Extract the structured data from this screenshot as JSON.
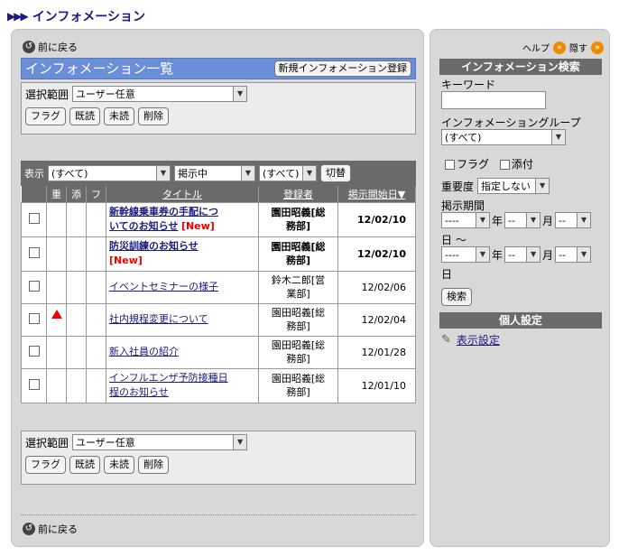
{
  "page": {
    "title": "インフォメーション"
  },
  "left": {
    "back_label": "前に戻る",
    "list_title": "インフォメーション一覧",
    "new_info_button": "新規インフォメーション登録",
    "scope_label": "選択範囲",
    "scope_value": "ユーザー任意",
    "actions": {
      "flag": "フラグ",
      "read": "既読",
      "unread": "未読",
      "delete": "削除"
    },
    "toolbar": {
      "display_label": "表示",
      "filter1": "(すべて)",
      "filter2": "掲示中",
      "filter3": "(すべて)",
      "switch_button": "切替"
    },
    "columns": {
      "importance": "重",
      "attachment": "添",
      "flag": "フ",
      "title": "タイトル",
      "registrant": "登録者",
      "start_date": "掲示開始日▼"
    },
    "rows": [
      {
        "title_line1": "新幹線乗車券の手配につ",
        "title_line2": "いてのお知らせ",
        "new": "[New]",
        "user_line1": "園田昭義[総",
        "user_line2": "務部]",
        "date": "12/02/10"
      },
      {
        "title_line1": "防災訓練のお知らせ",
        "title_line2": "",
        "new": "[New]",
        "user_line1": "園田昭義[総",
        "user_line2": "務部]",
        "date": "12/02/10"
      },
      {
        "title_line1": "イベントセミナーの様子",
        "title_line2": "",
        "new": "",
        "user_line1": "鈴木二郎[営",
        "user_line2": "業部]",
        "date": "12/02/06"
      },
      {
        "title_line1": "社内規程変更について",
        "title_line2": "",
        "new": "",
        "user_line1": "園田昭義[総",
        "user_line2": "務部]",
        "date": "12/02/04"
      },
      {
        "title_line1": "新入社員の紹介",
        "title_line2": "",
        "new": "",
        "user_line1": "園田昭義[総",
        "user_line2": "務部]",
        "date": "12/01/28"
      },
      {
        "title_line1": "インフルエンザ予防接種日",
        "title_line2": "程のお知らせ",
        "new": "",
        "user_line1": "園田昭義[総",
        "user_line2": "務部]",
        "date": "12/01/10"
      }
    ]
  },
  "right": {
    "help": "ヘルプ",
    "hide": "隠す",
    "search_title": "インフォメーション検索",
    "keyword_label": "キーワード",
    "group_label": "インフォメーショングループ",
    "group_value": "(すべて)",
    "flag_label": "フラグ",
    "attach_label": "添付",
    "importance_label": "重要度",
    "importance_value": "指定しない",
    "period_label": "掲示期間",
    "date_placeholder_year": "----",
    "date_placeholder": "--",
    "year_suffix": "年",
    "month_suffix": "月",
    "day_suffix": "日",
    "range_sep": "日 〜",
    "search_button": "検索",
    "personal_title": "個人設定",
    "display_settings": "表示設定"
  },
  "colors": {
    "header_blue": "#6a8fd8",
    "panel_gray": "#d8d8d8",
    "dark_gray": "#6a6a6a",
    "new_red": "#ee0000",
    "link_navy": "#1a1a80"
  }
}
